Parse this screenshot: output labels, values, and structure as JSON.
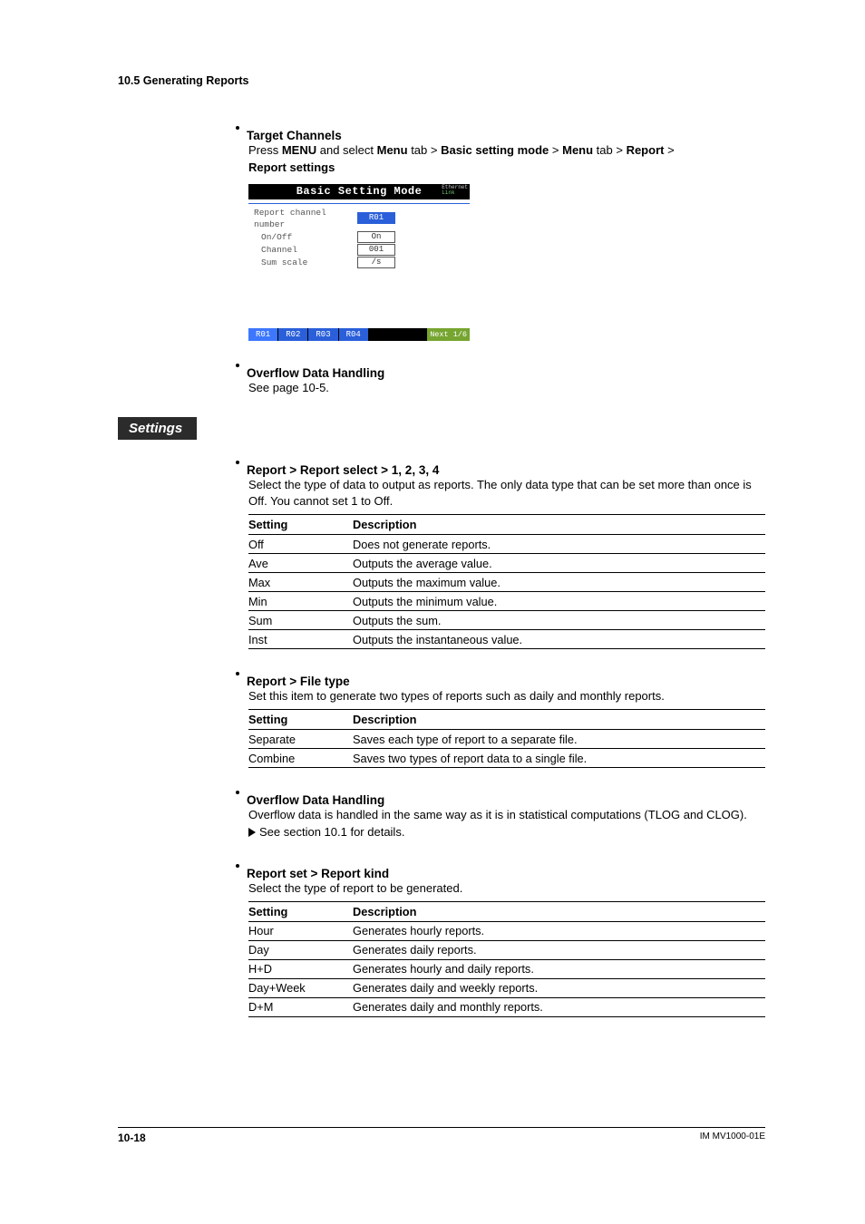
{
  "header": "10.5  Generating Reports",
  "target_channels": {
    "title": "Target Channels",
    "line": [
      "Press ",
      "MENU",
      " and select ",
      "Menu",
      " tab > ",
      "Basic setting mode",
      " > ",
      "Menu",
      " tab > ",
      "Report",
      " > ",
      "Report settings"
    ]
  },
  "screenshot": {
    "title": "Basic Setting Mode",
    "eth1": "Ethernet",
    "eth2": "Link",
    "rows": [
      {
        "label": "Report channel number",
        "val": "R01",
        "sel": true
      },
      {
        "label": "On/Off",
        "val": "On",
        "sel": false
      },
      {
        "label": "Channel",
        "val": "001",
        "sel": false
      },
      {
        "label": "Sum scale",
        "val": "/s",
        "sel": false
      }
    ],
    "tabs": [
      "R01",
      "R02",
      "R03",
      "R04"
    ],
    "next": "Next 1/6"
  },
  "overflow1": {
    "title": "Overflow Data Handling",
    "body": "See page 10-5."
  },
  "settings_tab": "Settings",
  "sect1": {
    "title": "Report > Report select > 1, 2, 3, 4",
    "body": "Select the type of data to output as reports. The only data type that can be set more than once is Off. You cannot set 1 to Off.",
    "th1": "Setting",
    "th2": "Description",
    "rows": [
      {
        "s": "Off",
        "d": "Does not generate reports."
      },
      {
        "s": "Ave",
        "d": "Outputs the average value."
      },
      {
        "s": "Max",
        "d": "Outputs the maximum value."
      },
      {
        "s": "Min",
        "d": "Outputs the minimum value."
      },
      {
        "s": "Sum",
        "d": "Outputs the sum."
      },
      {
        "s": "Inst",
        "d": "Outputs the instantaneous value."
      }
    ]
  },
  "sect2": {
    "title": "Report > File type",
    "body": "Set this item to generate two types of reports such as daily and monthly reports.",
    "th1": "Setting",
    "th2": "Description",
    "rows": [
      {
        "s": "Separate",
        "d": "Saves each type of report to a separate file."
      },
      {
        "s": "Combine",
        "d": "Saves two types of report data to a single file."
      }
    ]
  },
  "sect3": {
    "title": "Overflow Data Handling",
    "body": "Overflow data is handled in the same way as it is in statistical computations (TLOG and CLOG).",
    "ref": "See section 10.1 for details."
  },
  "sect4": {
    "title": "Report set > Report kind",
    "body": "Select the type of report to be generated.",
    "th1": "Setting",
    "th2": "Description",
    "rows": [
      {
        "s": "Hour",
        "d": "Generates hourly reports."
      },
      {
        "s": "Day",
        "d": "Generates daily reports."
      },
      {
        "s": "H+D",
        "d": "Generates hourly and daily reports."
      },
      {
        "s": "Day+Week",
        "d": "Generates daily and weekly reports."
      },
      {
        "s": "D+M",
        "d": "Generates daily and monthly reports."
      }
    ]
  },
  "footer": {
    "page": "10-18",
    "doc": "IM MV1000-01E"
  }
}
